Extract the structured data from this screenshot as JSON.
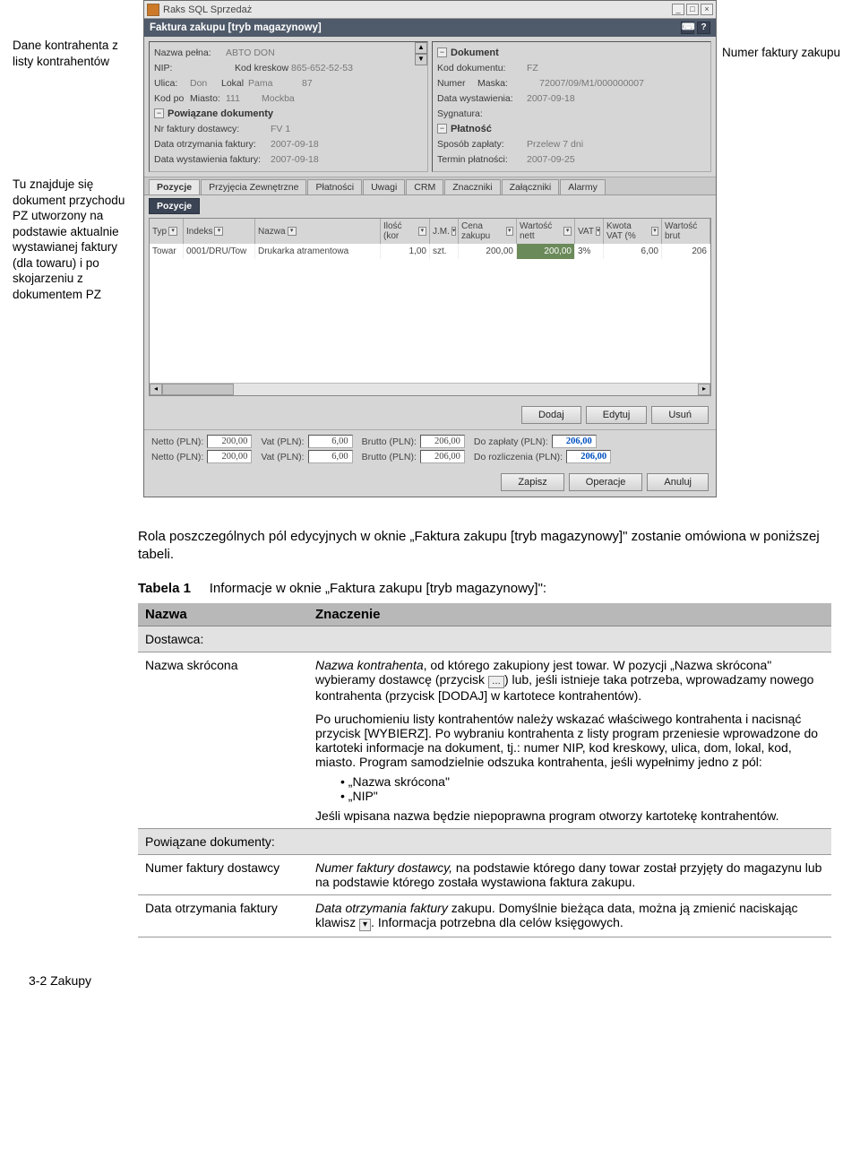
{
  "annotations": {
    "left1": "Dane kontrahenta z listy kontrahentów",
    "left2": "Tu znajduje się dokument przychodu PZ utworzony na podstawie aktualnie wystawianej faktury (dla towaru) i po skojarzeniu z dokumentem PZ",
    "right1": "Numer faktury zakupu"
  },
  "app": {
    "title": "Raks SQL Sprzedaż",
    "subtitle": "Faktura zakupu [tryb magazynowy]"
  },
  "left_panel": {
    "nazwa_pelna_lbl": "Nazwa pełna:",
    "nazwa_pelna": "ABTO DON",
    "nip_lbl": "NIP:",
    "nip": "",
    "kod_kreskow_lbl": "Kod kreskow",
    "kod_kreskow": "865-652-52-53",
    "ulica_lbl": "Ulica:",
    "ulica": "Don",
    "lokal_lbl": "Lokal",
    "lokal": "Pama",
    "lokal_no": "87",
    "kod_po_lbl": "Kod po",
    "miasto_lbl": "Miasto:",
    "kod_po": "111",
    "miasto": "Mockba",
    "powiazane_hdr": "Powiązane dokumenty",
    "nr_fakt_dost_lbl": "Nr faktury dostawcy:",
    "nr_fakt_dost": "FV 1",
    "data_otrz_lbl": "Data otrzymania faktury:",
    "data_otrz": "2007-09-18",
    "data_wyst_lbl": "Data wystawienia faktury:",
    "data_wyst": "2007-09-18"
  },
  "right_panel": {
    "dokument_hdr": "Dokument",
    "kod_dok_lbl": "Kod dokumentu:",
    "kod_dok": "FZ",
    "numer_lbl": "Numer",
    "maska_lbl": "Maska:",
    "numer": "7",
    "maska": "2007/09/M1/000000007",
    "data_wyst_lbl": "Data wystawienia:",
    "data_wyst": "2007-09-18",
    "sygnatura_lbl": "Sygnatura:",
    "sygnatura": "",
    "platnosc_hdr": "Płatność",
    "sposob_lbl": "Sposób zapłaty:",
    "sposob": "Przelew 7 dni",
    "termin_lbl": "Termin płatności:",
    "termin": "2007-09-25"
  },
  "tabs": [
    "Pozycje",
    "Przyjęcia Zewnętrzne",
    "Płatności",
    "Uwagi",
    "CRM",
    "Znaczniki",
    "Załączniki",
    "Alarmy"
  ],
  "subtab": "Pozycje",
  "grid": {
    "headers": [
      "Typ",
      "Indeks",
      "Nazwa",
      "Ilość (kor",
      "J.M.",
      "Cena zakupu",
      "Wartość nett",
      "VAT",
      "Kwota VAT (%",
      "Wartość brut"
    ],
    "row": {
      "typ": "Towar",
      "indeks": "0001/DRU/Tow",
      "nazwa": "Drukarka atramentowa",
      "ilosc": "1,00",
      "jm": "szt.",
      "cena": "200,00",
      "wart_nett": "200,00",
      "vat": "3%",
      "kwota_vat": "6,00",
      "wart_brut": "206"
    }
  },
  "buttons": {
    "dodaj": "Dodaj",
    "edytuj": "Edytuj",
    "usun": "Usuń",
    "zapisz": "Zapisz",
    "operacje": "Operacje",
    "anuluj": "Anuluj"
  },
  "totals": {
    "r1": {
      "netto_lbl": "Netto (PLN):",
      "netto": "200,00",
      "vat_lbl": "Vat (PLN):",
      "vat": "6,00",
      "brutto_lbl": "Brutto (PLN):",
      "brutto": "206,00",
      "zapl_lbl": "Do zapłaty (PLN):",
      "zapl": "206,00"
    },
    "r2": {
      "netto_lbl": "Netto (PLN):",
      "netto": "200,00",
      "vat_lbl": "Vat (PLN):",
      "vat": "6,00",
      "brutto_lbl": "Brutto (PLN):",
      "brutto": "206,00",
      "rozl_lbl": "Do rozliczenia (PLN):",
      "rozl": "206,00"
    }
  },
  "para1": "Rola poszczególnych pól edycyjnych w oknie „Faktura zakupu [tryb magazynowy]\" zostanie omówiona w poniższej tabeli.",
  "caption_b": "Tabela 1",
  "caption_t": "Informacje w oknie „Faktura zakupu [tryb magazynowy]\":",
  "table": {
    "h1": "Nazwa",
    "h2": "Znaczenie",
    "sec1": "Dostawca:",
    "r1c1": "Nazwa skrócona",
    "r1c2a": "Nazwa kontrahenta",
    "r1c2b": ", od którego zakupiony jest towar. W pozycji „Nazwa skrócona\" wybieramy dostawcę (przycisk ",
    "r1c2c": ") lub, jeśli istnieje taka potrzeba, wprowadzamy nowego kontrahenta (przycisk [DODAJ] w kartotece kontrahentów).",
    "r1c2d": "Po uruchomieniu listy kontrahentów należy wskazać właściwego kontrahenta i nacisnąć przycisk [WYBIERZ]. Po wybraniu kontrahenta z listy program przeniesie wprowadzone do kartoteki informacje na dokument, tj.: numer NIP, kod kreskowy, ulica, dom, lokal, kod, miasto. Program samodzielnie odszuka kontrahenta, jeśli wypełnimy jedno z pól:",
    "r1li1": "„Nazwa skrócona\"",
    "r1li2": "„NIP\"",
    "r1c2e": "Jeśli wpisana nazwa będzie niepoprawna program otworzy kartotekę kontrahentów.",
    "sec2": "Powiązane dokumenty:",
    "r2c1": "Numer faktury dostawcy",
    "r2c2a": "Numer faktury dostawcy,",
    "r2c2b": " na podstawie którego dany towar został przyjęty do magazynu lub na podstawie którego została wystawiona faktura zakupu.",
    "r3c1": "Data otrzymania faktury",
    "r3c2a": "Data otrzymania faktury",
    "r3c2b": " zakupu. Domyślnie bieżąca data, można ją zmienić naciskając klawisz ",
    "r3c2c": ". Informacja potrzebna dla celów księgowych."
  },
  "footer": "3-2  Zakupy"
}
